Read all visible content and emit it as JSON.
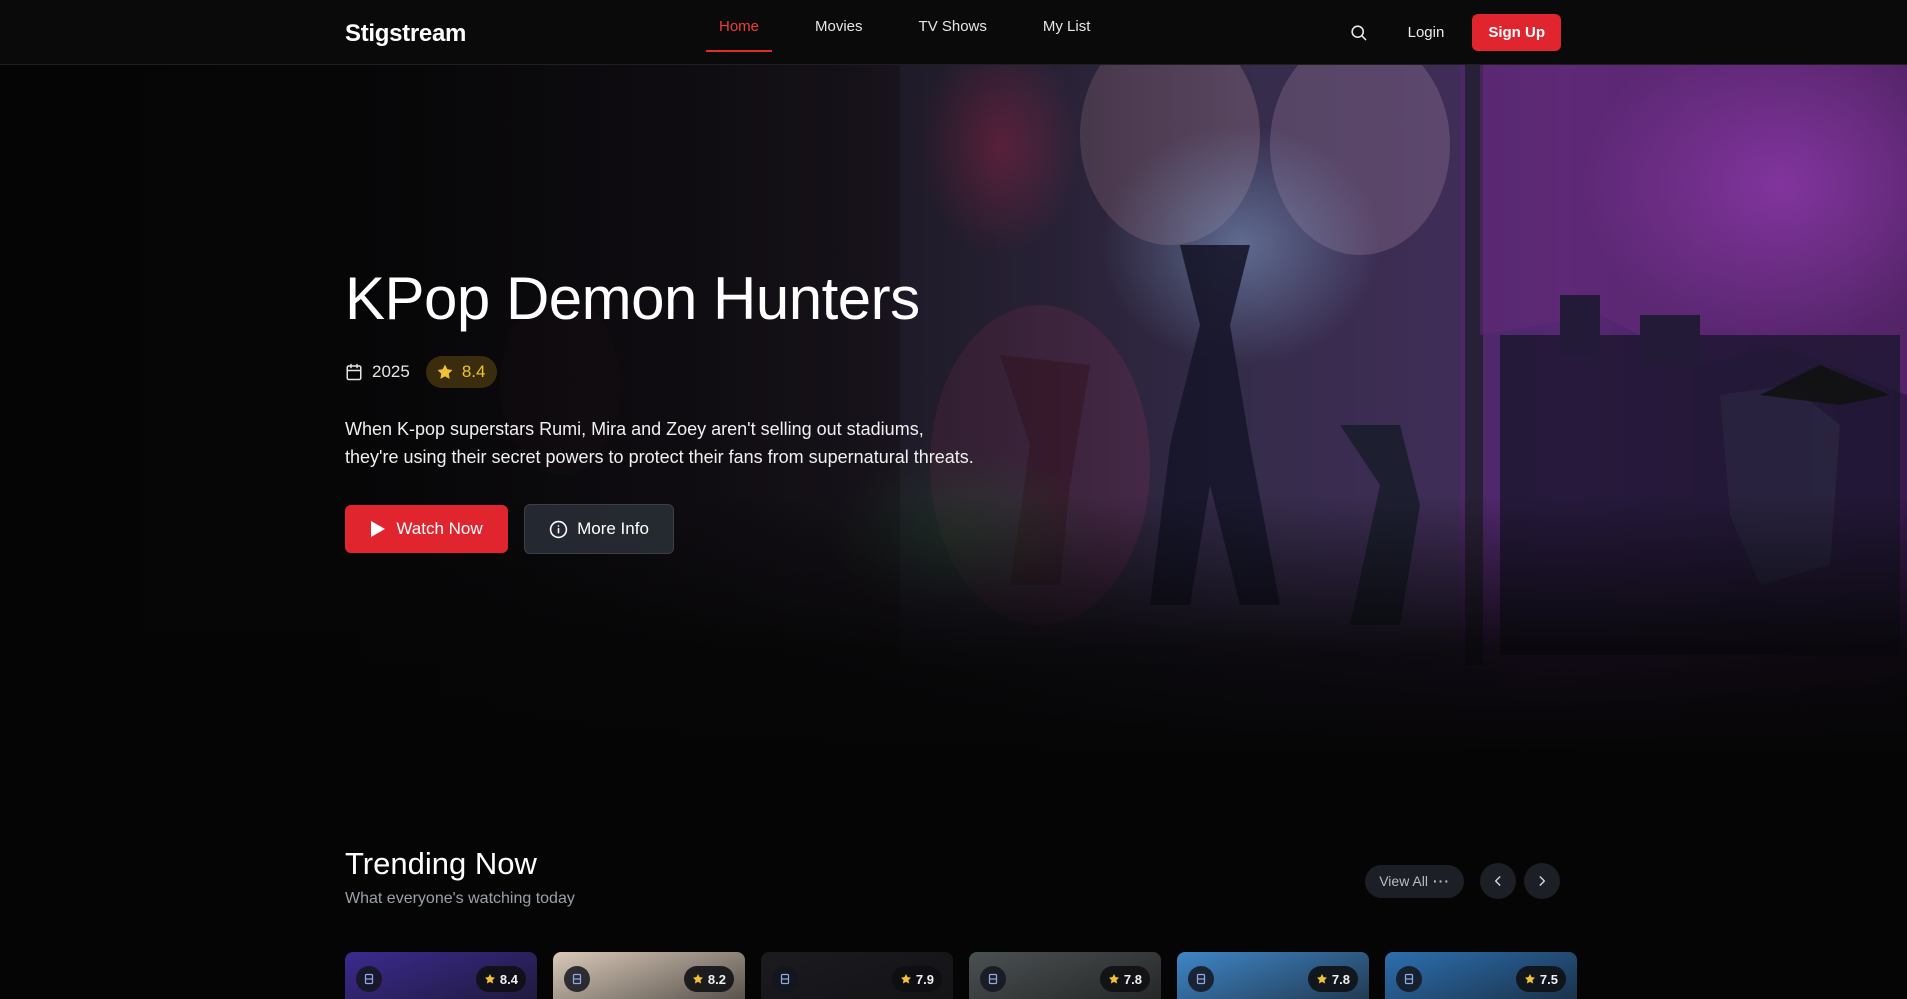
{
  "brand": {
    "logo": "Stigstream",
    "accent": "#e1252f"
  },
  "nav": {
    "links": [
      {
        "label": "Home",
        "active": true
      },
      {
        "label": "Movies",
        "active": false
      },
      {
        "label": "TV Shows",
        "active": false
      },
      {
        "label": "My List",
        "active": false
      }
    ],
    "search_icon": "search-icon",
    "login_label": "Login",
    "signup_label": "Sign Up"
  },
  "hero": {
    "title": "KPop Demon Hunters",
    "year": "2025",
    "rating": "8.4",
    "description": "When K-pop superstars Rumi, Mira and Zoey aren't selling out stadiums, they're using their secret powers to protect their fans from supernatural threats.",
    "watch_label": "Watch Now",
    "info_label": "More Info"
  },
  "trending": {
    "title": "Trending Now",
    "subtitle": "What everyone's watching today",
    "view_all_label": "View All",
    "cards": [
      {
        "rating": "8.4",
        "color": "#3b2a8f"
      },
      {
        "rating": "8.2",
        "color": "#d9c9b8"
      },
      {
        "rating": "7.9",
        "color": "#1a1a20"
      },
      {
        "rating": "7.8",
        "color": "#4a5052"
      },
      {
        "rating": "7.8",
        "color": "#3f86c8"
      },
      {
        "rating": "7.5",
        "color": "#2c6fb0"
      }
    ]
  }
}
